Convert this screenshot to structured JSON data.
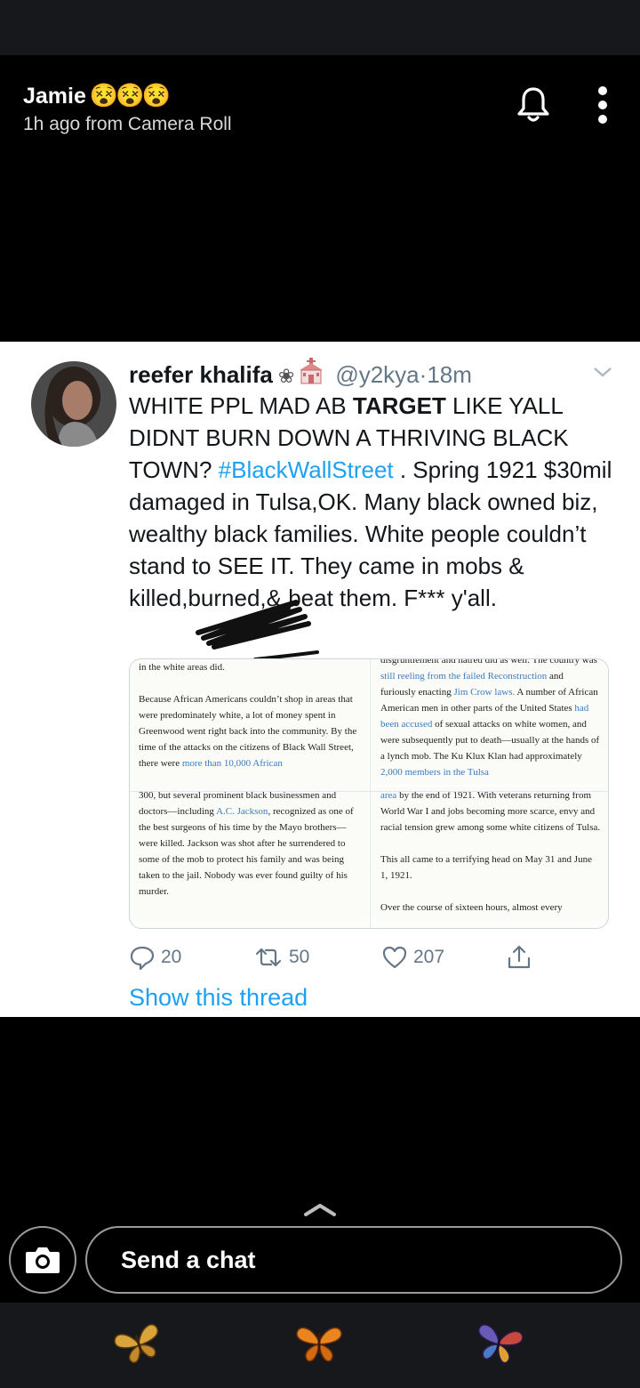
{
  "header": {
    "sender_name": "Jamie",
    "sender_emojis": "😵😵😵",
    "sender_meta": "1h ago from Camera Roll",
    "bell_icon": "bell-icon",
    "more_icon": "more-vertical-icon"
  },
  "tweet": {
    "display_name": "reefer khalifa",
    "name_emojis": "flower-icon, wedding-chapel-icon",
    "flower_glyph": "❀",
    "handle": "@y2kya",
    "separator": "·",
    "time": "18m",
    "body": {
      "part1": "WHITE PPL MAD AB ",
      "bold1": "TARGET",
      "part2": " LIKE YALL DIDNT BURN DOWN A THRIVING BLACK TOWN? ",
      "hashtag": "#BlackWallStreet",
      "part3": " . Spring 1921 $30mil damaged in Tulsa,OK. Many black owned biz, wealthy black families. White people couldn’t stand to SEE IT. They came in mobs & killed,burned,& beat them. F*** y'all."
    },
    "media_pages": {
      "p1": [
        "in the white areas did.",
        "Because African Americans couldn’t shop in areas that were predominately white, a lot of money spent in Greenwood went right back into the community. By the time of the attacks on the citizens of Black Wall Street, there were ",
        "more than 10,000 African"
      ],
      "p2": [
        "disgruntlement and hatred did as well. The country was ",
        "still reeling from the failed Reconstruction",
        " and furiously enacting ",
        "Jim Crow laws.",
        " A number of African American men in other parts of the United States ",
        "had been accused",
        " of sexual attacks on white women, and were subsequently put to death—usually at the hands of a lynch mob. The Ku Klux Klan had approximately ",
        "2,000 members in the Tulsa"
      ],
      "p3": [
        "300, but several prominent black businessmen and doctors—including ",
        "A.C. Jackson",
        ", recognized as one of the best surgeons of his time by the Mayo brothers—were killed. Jackson was shot after he surrendered to some of the mob to protect his family and was being taken to the jail. Nobody was ever found guilty of his murder."
      ],
      "p4": [
        "area",
        " by the end of 1921. With veterans returning from World War I and jobs becoming more scarce, envy and racial tension grew among some white citizens of Tulsa.",
        "This all came to a terrifying head on May 31 and June 1, 1921.",
        "Over the course of sixteen hours, almost every"
      ]
    },
    "actions": {
      "reply_count": "20",
      "retweet_count": "50",
      "like_count": "207"
    },
    "show_thread": "Show this thread"
  },
  "chat": {
    "placeholder": "Send a chat",
    "camera_icon": "camera-icon",
    "swipe_icon": "chevron-up-icon"
  },
  "bottom_bar": {
    "icons": [
      "butterfly-yellow-icon",
      "butterfly-orange-icon",
      "butterfly-purple-icon"
    ]
  },
  "colors": {
    "link_blue": "#1da1f2",
    "muted_gray": "#657786",
    "background": "#000000",
    "bar_dark": "#16181c"
  }
}
